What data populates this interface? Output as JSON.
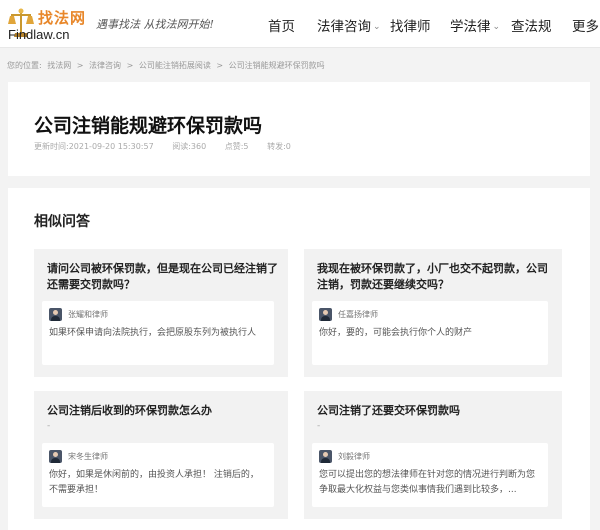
{
  "header": {
    "logo_cn": "找法网",
    "logo_en": "Findlaw.cn",
    "slogan": "遇事找法 从找法网开始!",
    "nav": [
      {
        "label": "首页",
        "has_dropdown": false
      },
      {
        "label": "法律咨询",
        "has_dropdown": true
      },
      {
        "label": "找律师",
        "has_dropdown": false
      },
      {
        "label": "学法律",
        "has_dropdown": true
      },
      {
        "label": "查法规",
        "has_dropdown": false
      },
      {
        "label": "更多",
        "has_dropdown": false
      }
    ]
  },
  "breadcrumb": {
    "prefix": "您的位置:",
    "items": [
      "找法网",
      "法律咨询",
      "公司能注销拓展阅读",
      "公司注销能规避环保罚款吗"
    ],
    "separator": ">"
  },
  "article": {
    "title": "公司注销能规避环保罚款吗",
    "updated": "更新时间:2021-09-20 15:30:57",
    "reads": "阅读:360",
    "likes": "点赞:5",
    "shares": "转发:0"
  },
  "similar": {
    "heading": "相似问答",
    "items": [
      {
        "question": "请问公司被环保罚款，但是现在公司已经注销了还需要交罚款吗？",
        "lawyer": "张耀和律师",
        "answer": "如果环保申请向法院执行，会把原股东列为被执行人"
      },
      {
        "question": "我现在被环保罚款了，小厂也交不起罚款，公司注销，罚款还要继续交吗？",
        "lawyer": "任嘉扬律师",
        "answer": "你好，要的，可能会执行你个人的财产"
      },
      {
        "question": "公司注销后收到的环保罚款怎么办",
        "dash": "-",
        "lawyer": "宋冬生律师",
        "answer": "你好，如果是休闲前的，由投资人承担！ 注销后的，不需要承担！"
      },
      {
        "question": "公司注销了还要交环保罚款吗",
        "dash": "-",
        "lawyer": "刘毅律师",
        "answer": "您可以提出您的想法律师在针对您的情况进行判断为您争取最大化权益与您类似事情我们遇到比较多，..."
      }
    ]
  },
  "colors": {
    "brand_orange": "#e8872a",
    "page_bg": "#f3f3f3",
    "card_bg": "#ffffff",
    "qa_bg": "#f2f2f2"
  }
}
